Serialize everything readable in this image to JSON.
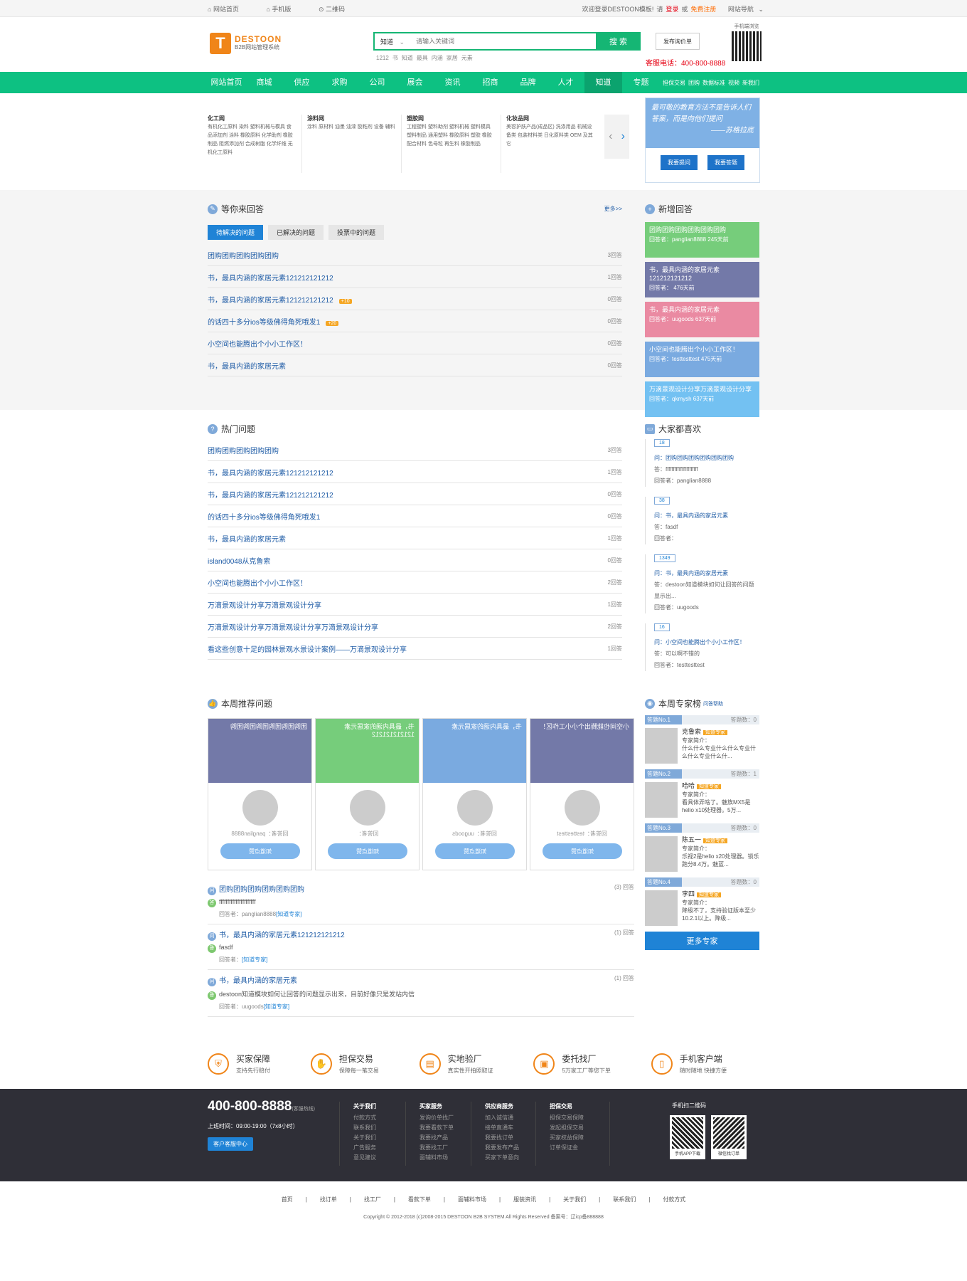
{
  "topbar": {
    "home": "网站首页",
    "mobile": "手机版",
    "qrcode": "二维码",
    "welcome": "欢迎登录DESTOON模板!",
    "please": "请",
    "login": "登录",
    "or": "或",
    "register": "免费注册",
    "sitenav": "网站导航"
  },
  "header": {
    "logo_brand": "DESTOON",
    "logo_sub": "B2B网站管理系统",
    "search_select": "知道",
    "search_placeholder": "请输入关键词",
    "search_button": "搜 索",
    "hotwords": [
      "1212",
      "书",
      "知道",
      "最具",
      "内涵",
      "家居",
      "元素"
    ],
    "ask_button": "发布询价单",
    "hotline": "客服电话：400-800-8888",
    "qr_label": "手机端浏览"
  },
  "nav": {
    "items": [
      "网站首页",
      "商城",
      "供应",
      "求购",
      "公司",
      "展会",
      "资讯",
      "招商",
      "品牌",
      "人才",
      "知道",
      "专题"
    ],
    "extras": [
      "担保交易",
      "团购",
      "数据标准",
      "视频",
      "新我们"
    ]
  },
  "cats": [
    {
      "title": "化工网",
      "text": "有机化工原料 染料 塑料机械与模具 食品添加剂 涂料 橡胶原料 化学助剂 橡胶制品 阻燃添加剂 合成树脂 化学纤维 无机化工原料"
    },
    {
      "title": "涂料网",
      "text": "涂料 原材料 油墨 油漆 胶粘剂 设备 辅料"
    },
    {
      "title": "塑胶网",
      "text": "工程塑料 塑料助剂 塑料机械 塑料模具 塑料制品 通用塑料 橡胶原料 塑胶 橡胶配合材料 色母粒 再生料 橡胶制品"
    },
    {
      "title": "化妆品网",
      "text": "美容护肤产品(成品区) 洗涤用品 机械设备类 包装材料类 日化原料类 OEM 及其它"
    }
  ],
  "slogan": {
    "text": "最可敬的教育方法不是告诉人们答案，而是向他们提问",
    "author": "——苏格拉底",
    "ask": "我要提问",
    "answer": "我要答题"
  },
  "waiting": {
    "title": "等你来回答",
    "more": "更多>>",
    "tabs": [
      "待解决的问题",
      "已解决的问题",
      "投票中的问题"
    ],
    "rows": [
      {
        "q": "团购团购团购团购团购",
        "reward": "",
        "count": "3回答"
      },
      {
        "q": "书，最具内涵的家居元素121212121212",
        "reward": "",
        "count": "1回答"
      },
      {
        "q": "书，最具内涵的家居元素121212121212",
        "reward": "+10",
        "count": "0回答"
      },
      {
        "q": "的话四十多分ios等级佛得角死哦发1",
        "reward": "+20",
        "count": "0回答"
      },
      {
        "q": "小空间也能腾出个小小工作区！",
        "reward": "",
        "count": "0回答"
      },
      {
        "q": "书，最具内涵的家居元素",
        "reward": "",
        "count": "0回答"
      }
    ]
  },
  "newans": {
    "title": "新增回答",
    "cards": [
      {
        "q": "团购团购团购团购团购团购",
        "sub": "回答者：panglian8888 245天前",
        "color": "#76cd7b"
      },
      {
        "q": "书，最具内涵的家居元素121212121212",
        "sub": "回答者： 476天前",
        "color": "#7379a8"
      },
      {
        "q": "书，最具内涵的家居元素",
        "sub": "回答者：uugoods 637天前",
        "color": "#ea8aa2"
      },
      {
        "q": "小空间也能腾出个小小工作区！",
        "sub": "回答者：testtesttest 475天前",
        "color": "#7aaae0"
      },
      {
        "q": "万滴景观设计分享万滴景观设计分享",
        "sub": "回答者：qkmysh 637天前",
        "color": "#73c1f2"
      }
    ]
  },
  "hot": {
    "title": "热门问题",
    "rows": [
      {
        "q": "团购团购团购团购团购",
        "count": "3回答"
      },
      {
        "q": "书，最具内涵的家居元素121212121212",
        "count": "1回答"
      },
      {
        "q": "书，最具内涵的家居元素121212121212",
        "count": "0回答"
      },
      {
        "q": "的话四十多分ios等级佛得角死哦发1",
        "count": "0回答"
      },
      {
        "q": "书，最具内涵的家居元素",
        "count": "1回答"
      },
      {
        "q": "island0048从克鲁索",
        "count": "0回答"
      },
      {
        "q": "小空间也能腾出个小小工作区！",
        "count": "2回答"
      },
      {
        "q": "万滴景观设计分享万滴景观设计分享",
        "count": "1回答"
      },
      {
        "q": "万滴景观设计分享万滴景观设计分享万滴景观设计分享",
        "count": "2回答"
      },
      {
        "q": "看这些创意十足的园林景观水景设计案例——万滴景观设计分享",
        "count": "1回答"
      }
    ]
  },
  "likes": {
    "title": "大家都喜欢",
    "items": [
      {
        "n": "18",
        "q": "问：团购团购团购团购团购团购",
        "a": "答：ffffffffffffffffffffff",
        "by": "回答者：panglian8888"
      },
      {
        "n": "38",
        "q": "问：书，最具内涵的家居元素",
        "a": "答：fasdf",
        "by": "回答者："
      },
      {
        "n": "1349",
        "q": "问：书，最具内涵的家居元素",
        "a": "答：destoon知道模块如何让回答的问题显示出...",
        "by": "回答者：uugoods"
      },
      {
        "n": "16",
        "q": "问：小空间也能腾出个小小工作区！",
        "a": "答：可以啊不错的",
        "by": "回答者：testtesttest"
      }
    ]
  },
  "recommend": {
    "title": "本周推荐问题",
    "cards": [
      {
        "top": "团购团购团购团购团购团购",
        "name": "回答者：panglian8888",
        "btn": "知道点赞",
        "color": "#7379a8"
      },
      {
        "top": "书，最具内涵的家居元素121212121212",
        "name": "回答者：",
        "btn": "知道点赞",
        "color": "#76cd7b"
      },
      {
        "top": "书，最具内涵的家居元素",
        "name": "回答者：uugoods",
        "btn": "知道点赞",
        "color": "#7aaae0"
      },
      {
        "top": "小空间也能腾出个小小工作区！",
        "name": "回答者：testtesttest",
        "btn": "知道点赞",
        "color": "#7379a8"
      }
    ],
    "rows": [
      {
        "q": "团购团购团购团购团购团购",
        "count": "(3) 回答",
        "a": "ffffffffffffffffffffff",
        "by": "回答者：panglian8888",
        "tag": "[知道专家]"
      },
      {
        "q": "书，最具内涵的家居元素121212121212",
        "count": "(1) 回答",
        "a": "fasdf",
        "by": "回答者：",
        "tag": "[知道专家]"
      },
      {
        "q": "书，最具内涵的家居元素",
        "count": "(1) 回答",
        "a": "destoon知道模块如何让回答的问题显示出来，目前好像只是发站内信",
        "by": "回答者：uugoods",
        "tag": "[知道专家]"
      }
    ]
  },
  "experts": {
    "title": "本周专家榜",
    "sub": "问答帮助",
    "items": [
      {
        "no": "答题No.1",
        "cnt": "答题数：0",
        "name": "克鲁索",
        "tag": "知道专家",
        "intro": "专家简介：",
        "desc": "什么什么专业什么什么专业什么什么专业什么什..."
      },
      {
        "no": "答题No.2",
        "cnt": "答题数：1",
        "name": "哈哈",
        "tag": "知道专家",
        "intro": "专家简介：",
        "desc": "看具体弄啥了。魅族MX5是helio x10处理器。5万..."
      },
      {
        "no": "答题No.3",
        "cnt": "答题数：0",
        "name": "陈五一",
        "tag": "知道专家",
        "intro": "专家简介：",
        "desc": "乐视2是helio x20处理器。锁乐跑分8.4万。魅蓝..."
      },
      {
        "no": "答题No.4",
        "cnt": "答题数：0",
        "name": "李四",
        "tag": "知道专家",
        "intro": "专家简介：",
        "desc": "降级不了，支持验证版本至少10.2.1以上。降级..."
      }
    ],
    "more": "更多专家"
  },
  "guarantee": [
    {
      "t": "买家保障",
      "s": "支持先行赔付",
      "icon": "shield-icon"
    },
    {
      "t": "担保交易",
      "s": "保障每一笔交易",
      "icon": "handshake-icon"
    },
    {
      "t": "实地验厂",
      "s": "真实性开拍照取证",
      "icon": "book-icon"
    },
    {
      "t": "委托找厂",
      "s": "5万家工厂等您下单",
      "icon": "briefcase-icon"
    },
    {
      "t": "手机客户端",
      "s": "随时随地 快捷方便",
      "icon": "phone-icon"
    }
  ],
  "footer": {
    "tel": "400-800-8888",
    "tel_sub": "(客服热线)",
    "hours": "上班时间：09:00-19:00（7x8小时）",
    "service": "客户客服中心",
    "cols": [
      {
        "t": "关于我们",
        "items": [
          "付款方式",
          "联系我们",
          "关于我们",
          "广告服务",
          "意见建议"
        ]
      },
      {
        "t": "买家服务",
        "items": [
          "发询价单找厂",
          "我要看款下单",
          "我要找产品",
          "我要找工厂",
          "面辅料市场"
        ]
      },
      {
        "t": "供应商服务",
        "items": [
          "加入诚信通",
          "接单直通车",
          "我要找订单",
          "我要发布产品",
          "买家下单意向"
        ]
      },
      {
        "t": "担保交易",
        "items": [
          "担保交易保障",
          "发起担保交易",
          "买家权益保障",
          "订单保证金"
        ]
      }
    ],
    "qr_title": "手机扫二维码",
    "qr_app": "手机APP下载",
    "qr_wx": "微信找订单",
    "links": [
      "首页",
      "找订单",
      "找工厂",
      "看款下单",
      "面辅料市场",
      "服装资讯",
      "关于我们",
      "联系我们",
      "付款方式"
    ],
    "copyright": "Copyright © 2012-2018 (c)2008-2015 DESTOON B2B SYSTEM All Rights Reserved 备案号：辽icp备888888"
  }
}
